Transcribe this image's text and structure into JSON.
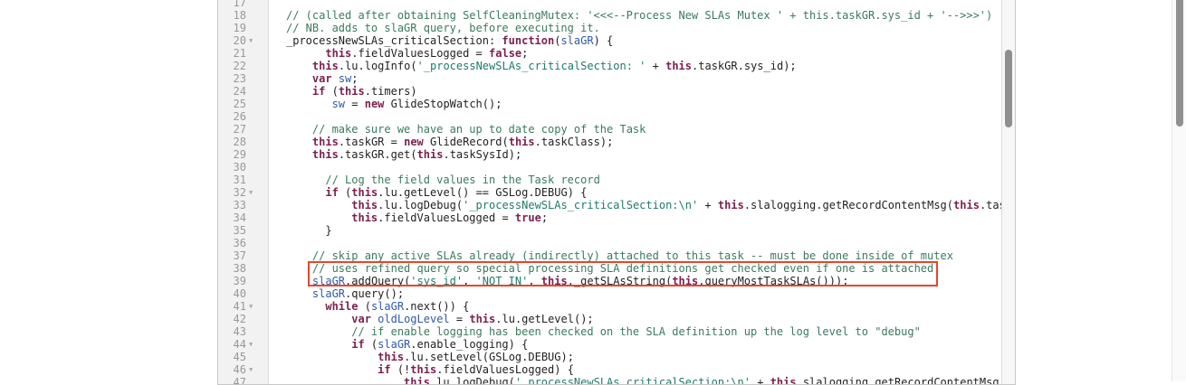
{
  "editor": {
    "lines": [
      {
        "n": "17",
        "fold": false,
        "text": ""
      },
      {
        "n": "18",
        "fold": false,
        "text": "// (called after obtaining SelfCleaningMutex: '<<<--Process New SLAs Mutex ' + this.taskGR.sys_id + '-->>>')"
      },
      {
        "n": "19",
        "fold": false,
        "text": "// NB. adds to slaGR query, before executing it."
      },
      {
        "n": "20",
        "fold": true,
        "text": "_processNewSLAs_criticalSection: function(slaGR) {"
      },
      {
        "n": "21",
        "fold": false,
        "text": "      this.fieldValuesLogged = false;"
      },
      {
        "n": "22",
        "fold": false,
        "text": "    this.lu.logInfo('_processNewSLAs_criticalSection: ' + this.taskGR.sys_id);"
      },
      {
        "n": "23",
        "fold": false,
        "text": "    var sw;"
      },
      {
        "n": "24",
        "fold": false,
        "text": "    if (this.timers)"
      },
      {
        "n": "25",
        "fold": false,
        "text": "       sw = new GlideStopWatch();"
      },
      {
        "n": "26",
        "fold": false,
        "text": ""
      },
      {
        "n": "27",
        "fold": false,
        "text": "    // make sure we have an up to date copy of the Task"
      },
      {
        "n": "28",
        "fold": false,
        "text": "    this.taskGR = new GlideRecord(this.taskClass);"
      },
      {
        "n": "29",
        "fold": false,
        "text": "    this.taskGR.get(this.taskSysId);"
      },
      {
        "n": "30",
        "fold": false,
        "text": ""
      },
      {
        "n": "31",
        "fold": false,
        "text": "      // Log the field values in the Task record"
      },
      {
        "n": "32",
        "fold": true,
        "text": "      if (this.lu.getLevel() == GSLog.DEBUG) {"
      },
      {
        "n": "33",
        "fold": false,
        "text": "          this.lu.logDebug('_processNewSLAs_criticalSection:\\n' + this.slalogging.getRecordContentMsg(this.taskGR));"
      },
      {
        "n": "34",
        "fold": false,
        "text": "          this.fieldValuesLogged = true;"
      },
      {
        "n": "35",
        "fold": false,
        "text": "      }"
      },
      {
        "n": "36",
        "fold": false,
        "text": ""
      },
      {
        "n": "37",
        "fold": false,
        "text": "    // skip any active SLAs already (indirectly) attached to this task -- must be done inside of mutex"
      },
      {
        "n": "38",
        "fold": false,
        "text": "    // uses refined query so special processing SLA definitions get checked even if one is attached"
      },
      {
        "n": "39",
        "fold": false,
        "text": "    slaGR.addQuery('sys_id', 'NOT IN', this._getSLAsString(this.queryMostTaskSLAs()));"
      },
      {
        "n": "40",
        "fold": false,
        "text": "    slaGR.query();"
      },
      {
        "n": "41",
        "fold": true,
        "text": "      while (slaGR.next()) {"
      },
      {
        "n": "42",
        "fold": false,
        "text": "          var oldLogLevel = this.lu.getLevel();"
      },
      {
        "n": "43",
        "fold": false,
        "text": "          // if enable logging has been checked on the SLA definition up the log level to \"debug\""
      },
      {
        "n": "44",
        "fold": true,
        "text": "          if (slaGR.enable_logging) {"
      },
      {
        "n": "45",
        "fold": false,
        "text": "              this.lu.setLevel(GSLog.DEBUG);"
      },
      {
        "n": "46",
        "fold": true,
        "text": "              if (!this.fieldValuesLogged) {"
      },
      {
        "n": "47",
        "fold": false,
        "text": "                  this.lu.logDebug('_processNewSLAs_criticalSection:\\n' + this.slalogging.getRecordContentMsg(this.taskGR));"
      }
    ]
  },
  "colors": {
    "highlight_box": "#e8452c",
    "comment": "#3b7a5e",
    "keyword": "#7b1f4f",
    "string": "#1f7a6c",
    "variable": "#2e5aa8"
  }
}
